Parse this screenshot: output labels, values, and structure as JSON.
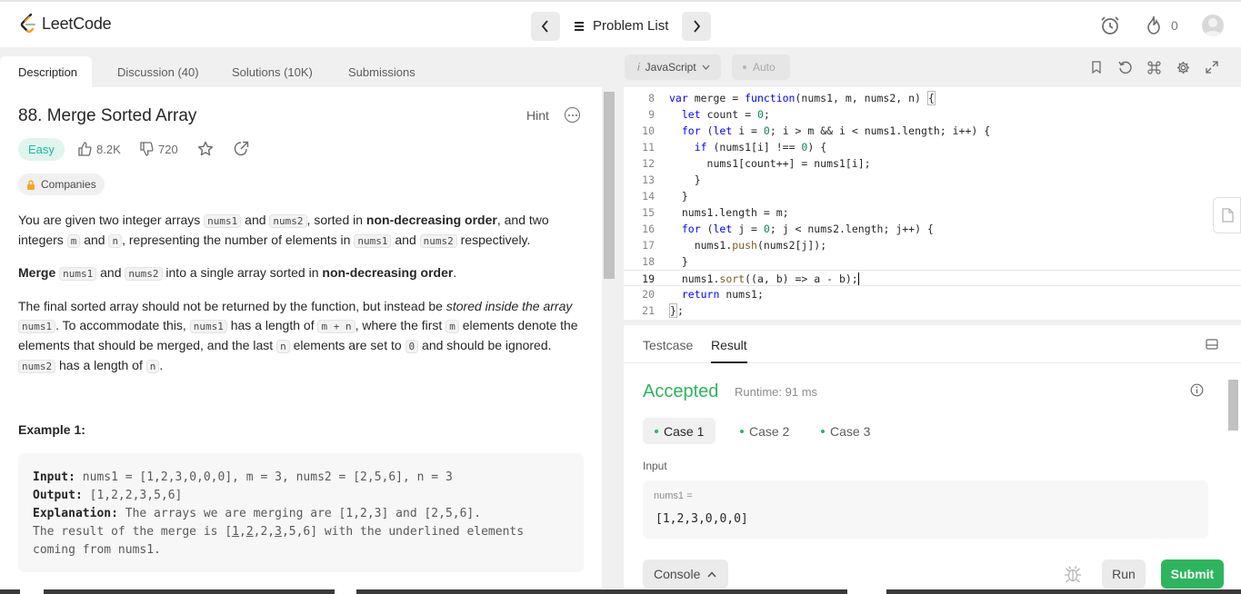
{
  "nav": {
    "logo": "LeetCode",
    "problem_list": "Problem List",
    "streak": "0"
  },
  "left_tabs": [
    "Description",
    "Discussion (40)",
    "Solutions (10K)",
    "Submissions"
  ],
  "problem": {
    "title": "88. Merge Sorted Array",
    "hint": "Hint",
    "difficulty": "Easy",
    "likes": "8.2K",
    "dislikes": "720",
    "companies": "Companies"
  },
  "description": {
    "p1": [
      "You are given two integer arrays ",
      "nums1",
      " and ",
      "nums2",
      ", sorted in ",
      "non-decreasing order",
      ", and two integers ",
      "m",
      " and ",
      "n",
      ", representing the number of elements in ",
      "nums1",
      " and ",
      "nums2",
      " respectively."
    ],
    "p2": [
      "Merge",
      " ",
      "nums1",
      " and ",
      "nums2",
      " into a single array sorted in ",
      "non-decreasing order",
      "."
    ],
    "p3": [
      "The final sorted array should not be returned by the function, but instead be ",
      "stored inside the array",
      " ",
      "nums1",
      ". To accommodate this, ",
      "nums1",
      " has a length of ",
      "m + n",
      ", where the first ",
      "m",
      " elements denote the elements that should be merged, and the last ",
      "n",
      " elements are set to ",
      "0",
      " and should be ignored. ",
      "nums2",
      " has a length of ",
      "n",
      "."
    ]
  },
  "example": {
    "title": "Example 1:",
    "input_label": "Input:",
    "input": " nums1 = [1,2,3,0,0,0], m = 3, nums2 = [2,5,6], n = 3",
    "output_label": "Output:",
    "output": " [1,2,2,3,5,6]",
    "explanation_label": "Explanation:",
    "explanation": " The arrays we are merging are [1,2,3] and [2,5,6].",
    "result_pre": "The result of the merge is [",
    "u1": "1",
    "sep1": ",",
    "u2": "2",
    "mid": ",2,",
    "u3": "3",
    "result_post": ",5,6] with the underlined elements",
    "line_last": "coming from nums1."
  },
  "editor": {
    "language": "JavaScript",
    "auto": "Auto",
    "lines": [
      {
        "n": "8",
        "t": "var merge = function(nums1, m, nums2, n) {"
      },
      {
        "n": "9",
        "t": "  let count = 0;"
      },
      {
        "n": "10",
        "t": "  for (let i = 0; i > m && i < nums1.length; i++) {"
      },
      {
        "n": "11",
        "t": "    if (nums1[i] !== 0) {"
      },
      {
        "n": "12",
        "t": "      nums1[count++] = nums1[i];"
      },
      {
        "n": "13",
        "t": "    }"
      },
      {
        "n": "14",
        "t": "  }"
      },
      {
        "n": "15",
        "t": "  nums1.length = m;"
      },
      {
        "n": "16",
        "t": "  for (let j = 0; j < nums2.length; j++) {"
      },
      {
        "n": "17",
        "t": "    nums1.push(nums2[j]);"
      },
      {
        "n": "18",
        "t": "  }"
      },
      {
        "n": "19",
        "t": "  nums1.sort((a, b) => a - b);"
      },
      {
        "n": "20",
        "t": "  return nums1;"
      },
      {
        "n": "21",
        "t": "};"
      }
    ]
  },
  "result": {
    "tabs": [
      "Testcase",
      "Result"
    ],
    "status": "Accepted",
    "runtime": "Runtime: 91 ms",
    "cases": [
      "Case 1",
      "Case 2",
      "Case 3"
    ],
    "input_label": "Input",
    "input_name": "nums1 =",
    "input_value": "[1,2,3,0,0,0]"
  },
  "footer": {
    "console": "Console",
    "run": "Run",
    "submit": "Submit"
  },
  "colors": {
    "accent_green": "#2db55d",
    "easy": "#1cb8a0",
    "background": "#f0f0f0"
  }
}
